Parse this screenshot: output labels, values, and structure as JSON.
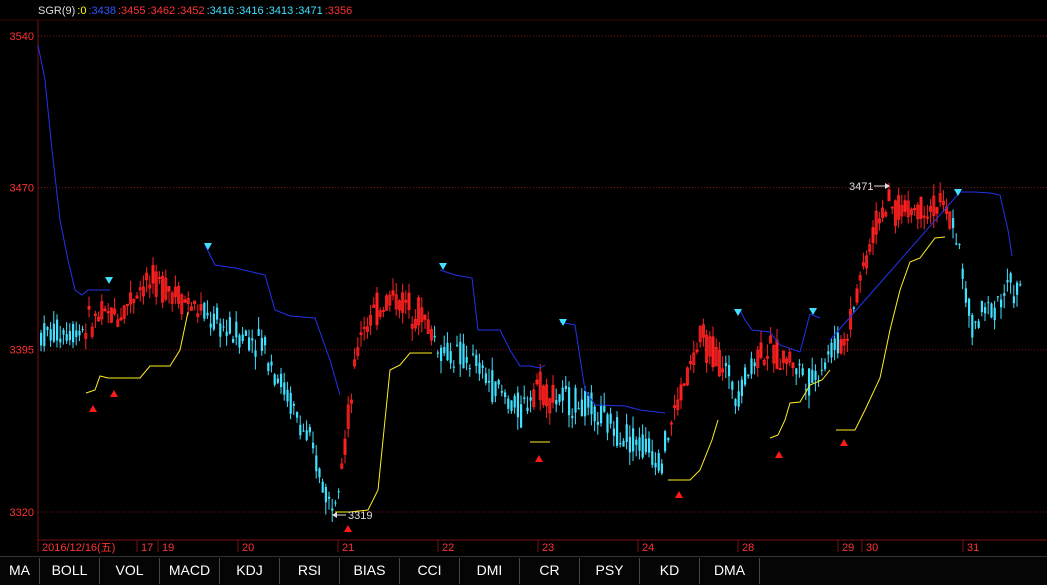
{
  "indicator": {
    "name": "SGR(9)",
    "values": [
      {
        "text": ":0",
        "color": "#ffff00"
      },
      {
        "text": ":3438",
        "color": "#3355ff"
      },
      {
        "text": ":3455",
        "color": "#ff3333"
      },
      {
        "text": ":3462",
        "color": "#ff3333"
      },
      {
        "text": ":3452",
        "color": "#ff3333"
      },
      {
        "text": ":3416",
        "color": "#40e0ff"
      },
      {
        "text": ":3416",
        "color": "#40e0ff"
      },
      {
        "text": ":3413",
        "color": "#40e0ff"
      },
      {
        "text": ":3471",
        "color": "#40e0ff"
      },
      {
        "text": ":3356",
        "color": "#ff3333"
      }
    ]
  },
  "chart_data": {
    "type": "candlestick",
    "y_ticks": [
      3540,
      3470,
      3395,
      3320
    ],
    "ylim": [
      3313,
      3547
    ],
    "x_labels": [
      "2016/12/16(五)",
      "17",
      "19",
      "20",
      "21",
      "22",
      "23",
      "24",
      "28",
      "29",
      "30",
      "31"
    ],
    "annotations": [
      {
        "text": "3471",
        "type": "high"
      },
      {
        "text": "3319",
        "type": "low"
      }
    ],
    "colors": {
      "up": "#ff2020",
      "down": "#40e0ff",
      "blue_line": "#2233ee",
      "yellow_line": "#ffee22",
      "grid": "#7a1010"
    }
  },
  "tabs": [
    "MA",
    "BOLL",
    "VOL",
    "MACD",
    "KDJ",
    "RSI",
    "BIAS",
    "CCI",
    "DMI",
    "CR",
    "PSY",
    "KD",
    "DMA"
  ]
}
